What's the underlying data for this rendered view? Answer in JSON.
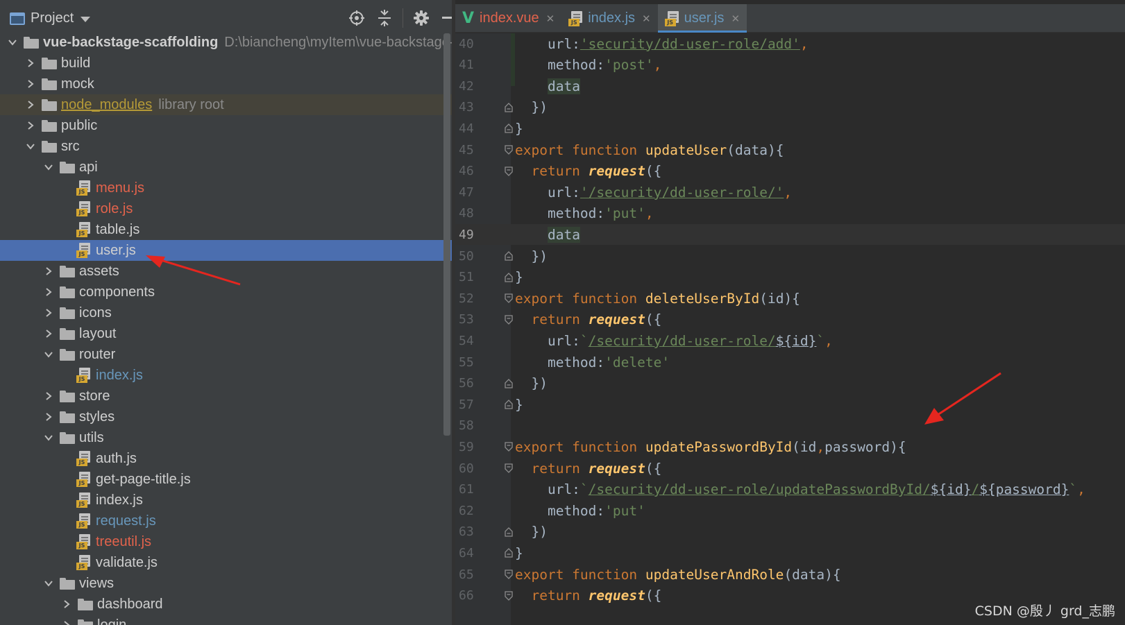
{
  "project_panel": {
    "title": "Project",
    "tree": [
      {
        "depth": 0,
        "chevron": "down",
        "type": "folder",
        "name": "vue-backstage-scaffolding",
        "bold": true,
        "path": "D:\\biancheng\\myItem\\vue-backstage-scaf"
      },
      {
        "depth": 1,
        "chevron": "right",
        "type": "folder",
        "name": "build"
      },
      {
        "depth": 1,
        "chevron": "right",
        "type": "folder",
        "name": "mock"
      },
      {
        "depth": 1,
        "chevron": "right",
        "type": "folder",
        "name": "node_modules",
        "suffix": "library root",
        "style": "lib"
      },
      {
        "depth": 1,
        "chevron": "right",
        "type": "folder",
        "name": "public"
      },
      {
        "depth": 1,
        "chevron": "down",
        "type": "folder",
        "name": "src"
      },
      {
        "depth": 2,
        "chevron": "down",
        "type": "folder",
        "name": "api"
      },
      {
        "depth": 3,
        "chevron": "none",
        "type": "js",
        "name": "menu.js",
        "color": "red"
      },
      {
        "depth": 3,
        "chevron": "none",
        "type": "js",
        "name": "role.js",
        "color": "red"
      },
      {
        "depth": 3,
        "chevron": "none",
        "type": "js",
        "name": "table.js"
      },
      {
        "depth": 3,
        "chevron": "none",
        "type": "js",
        "name": "user.js",
        "selected": true
      },
      {
        "depth": 2,
        "chevron": "right",
        "type": "folder",
        "name": "assets"
      },
      {
        "depth": 2,
        "chevron": "right",
        "type": "folder",
        "name": "components"
      },
      {
        "depth": 2,
        "chevron": "right",
        "type": "folder",
        "name": "icons"
      },
      {
        "depth": 2,
        "chevron": "right",
        "type": "folder",
        "name": "layout"
      },
      {
        "depth": 2,
        "chevron": "down",
        "type": "folder",
        "name": "router"
      },
      {
        "depth": 3,
        "chevron": "none",
        "type": "js",
        "name": "index.js",
        "color": "blue"
      },
      {
        "depth": 2,
        "chevron": "right",
        "type": "folder",
        "name": "store"
      },
      {
        "depth": 2,
        "chevron": "right",
        "type": "folder",
        "name": "styles"
      },
      {
        "depth": 2,
        "chevron": "down",
        "type": "folder",
        "name": "utils"
      },
      {
        "depth": 3,
        "chevron": "none",
        "type": "js",
        "name": "auth.js"
      },
      {
        "depth": 3,
        "chevron": "none",
        "type": "js",
        "name": "get-page-title.js"
      },
      {
        "depth": 3,
        "chevron": "none",
        "type": "js",
        "name": "index.js"
      },
      {
        "depth": 3,
        "chevron": "none",
        "type": "js",
        "name": "request.js",
        "color": "blue"
      },
      {
        "depth": 3,
        "chevron": "none",
        "type": "js",
        "name": "treeutil.js",
        "color": "red"
      },
      {
        "depth": 3,
        "chevron": "none",
        "type": "js",
        "name": "validate.js"
      },
      {
        "depth": 2,
        "chevron": "down",
        "type": "folder",
        "name": "views"
      },
      {
        "depth": 3,
        "chevron": "right",
        "type": "folder",
        "name": "dashboard"
      },
      {
        "depth": 3,
        "chevron": "right",
        "type": "folder",
        "name": "login"
      }
    ]
  },
  "editor": {
    "tabs": [
      {
        "label": "index.vue",
        "kind": "vue"
      },
      {
        "label": "index.js",
        "kind": "js"
      },
      {
        "label": "user.js",
        "kind": "js",
        "active": true
      }
    ],
    "current_line": 49,
    "lines": [
      {
        "n": "40",
        "fold": "",
        "tokens": [
          [
            "p",
            "    url:"
          ],
          [
            "url",
            "'security/dd-user-role/add'"
          ],
          [
            "cm",
            ","
          ]
        ]
      },
      {
        "n": "41",
        "fold": "",
        "tokens": [
          [
            "p",
            "    method:"
          ],
          [
            "str",
            "'post'"
          ],
          [
            "cm",
            ","
          ]
        ]
      },
      {
        "n": "42",
        "fold": "",
        "tokens": [
          [
            "p",
            "    "
          ],
          [
            "hl",
            "data"
          ]
        ]
      },
      {
        "n": "43",
        "fold": "end",
        "tokens": [
          [
            "p",
            "  })"
          ]
        ]
      },
      {
        "n": "44",
        "fold": "end",
        "tokens": [
          [
            "p",
            "}"
          ]
        ]
      },
      {
        "n": "45",
        "fold": "start",
        "tokens": [
          [
            "kw",
            "export function "
          ],
          [
            "fn",
            "updateUser"
          ],
          [
            "p",
            "(data){"
          ]
        ]
      },
      {
        "n": "46",
        "fold": "start",
        "tokens": [
          [
            "kw",
            "  return "
          ],
          [
            "call",
            "request"
          ],
          [
            "p",
            "({"
          ]
        ]
      },
      {
        "n": "47",
        "fold": "",
        "tokens": [
          [
            "p",
            "    url:"
          ],
          [
            "url",
            "'/security/dd-user-role/'"
          ],
          [
            "cm",
            ","
          ]
        ]
      },
      {
        "n": "48",
        "fold": "",
        "tokens": [
          [
            "p",
            "    method:"
          ],
          [
            "str",
            "'put'"
          ],
          [
            "cm",
            ","
          ]
        ]
      },
      {
        "n": "49",
        "fold": "",
        "tokens": [
          [
            "p",
            "    "
          ],
          [
            "hl",
            "data"
          ]
        ]
      },
      {
        "n": "50",
        "fold": "end",
        "tokens": [
          [
            "p",
            "  })"
          ]
        ]
      },
      {
        "n": "51",
        "fold": "end",
        "tokens": [
          [
            "p",
            "}"
          ]
        ]
      },
      {
        "n": "52",
        "fold": "start",
        "tokens": [
          [
            "kw",
            "export function "
          ],
          [
            "fn",
            "deleteUserById"
          ],
          [
            "p",
            "(id){"
          ]
        ]
      },
      {
        "n": "53",
        "fold": "start",
        "tokens": [
          [
            "kw",
            "  return "
          ],
          [
            "call",
            "request"
          ],
          [
            "p",
            "({"
          ]
        ]
      },
      {
        "n": "54",
        "fold": "",
        "tokens": [
          [
            "p",
            "    url:"
          ],
          [
            "str",
            "`"
          ],
          [
            "url",
            "/security/dd-user-role/"
          ],
          [
            "tpl",
            "${id}"
          ],
          [
            "str",
            "`"
          ],
          [
            "cm",
            ","
          ]
        ]
      },
      {
        "n": "55",
        "fold": "",
        "tokens": [
          [
            "p",
            "    method:"
          ],
          [
            "str",
            "'delete'"
          ]
        ]
      },
      {
        "n": "56",
        "fold": "end",
        "tokens": [
          [
            "p",
            "  })"
          ]
        ]
      },
      {
        "n": "57",
        "fold": "end",
        "tokens": [
          [
            "p",
            "}"
          ]
        ]
      },
      {
        "n": "58",
        "fold": "",
        "tokens": []
      },
      {
        "n": "59",
        "fold": "start",
        "tokens": [
          [
            "kw",
            "export function "
          ],
          [
            "fn",
            "updatePasswordById"
          ],
          [
            "p",
            "(id"
          ],
          [
            "cm",
            ","
          ],
          [
            "p",
            "password){"
          ]
        ]
      },
      {
        "n": "60",
        "fold": "start",
        "tokens": [
          [
            "kw",
            "  return "
          ],
          [
            "call",
            "request"
          ],
          [
            "p",
            "({"
          ]
        ]
      },
      {
        "n": "61",
        "fold": "",
        "tokens": [
          [
            "p",
            "    url:"
          ],
          [
            "str",
            "`"
          ],
          [
            "url",
            "/security/dd-user-role/updatePasswordById/"
          ],
          [
            "tpl",
            "${id}"
          ],
          [
            "url",
            "/"
          ],
          [
            "tpl",
            "${password}"
          ],
          [
            "str",
            "`"
          ],
          [
            "cm",
            ","
          ]
        ]
      },
      {
        "n": "62",
        "fold": "",
        "tokens": [
          [
            "p",
            "    method:"
          ],
          [
            "str",
            "'put'"
          ]
        ]
      },
      {
        "n": "63",
        "fold": "end",
        "tokens": [
          [
            "p",
            "  })"
          ]
        ]
      },
      {
        "n": "64",
        "fold": "end",
        "tokens": [
          [
            "p",
            "}"
          ]
        ]
      },
      {
        "n": "65",
        "fold": "start",
        "tokens": [
          [
            "kw",
            "export function "
          ],
          [
            "fn",
            "updateUserAndRole"
          ],
          [
            "p",
            "(data){"
          ]
        ]
      },
      {
        "n": "66",
        "fold": "start",
        "tokens": [
          [
            "kw",
            "  return "
          ],
          [
            "call",
            "request"
          ],
          [
            "p",
            "({"
          ]
        ]
      }
    ]
  },
  "watermark": "CSDN @殷丿 grd_志鹏",
  "icons": {
    "tool_1": "locate-icon",
    "tool_2": "collapse-all-icon",
    "tool_3": "settings-gear-icon",
    "tool_4": "hide-icon"
  },
  "colors": {
    "selected_row": "#4b6eaf",
    "annotation_arrow": "#e5261f"
  }
}
